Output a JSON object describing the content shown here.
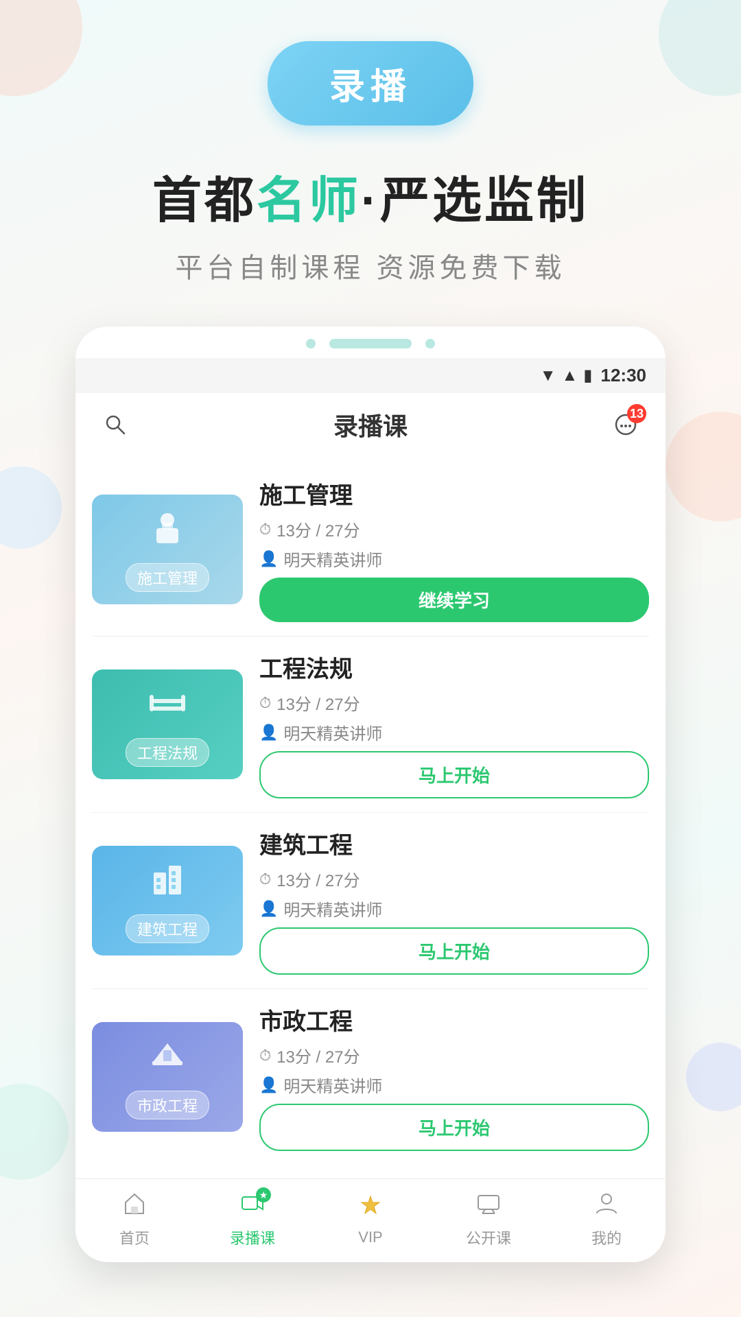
{
  "app": {
    "title": "录播课"
  },
  "header": {
    "button_label": "录播",
    "headline_part1": "首都",
    "headline_accent": "名师",
    "headline_part2": "·严选监制",
    "subheadline": "平台自制课程 资源免费下载"
  },
  "phone": {
    "status": {
      "time": "12:30"
    },
    "topbar": {
      "title": "录播课",
      "search_aria": "搜索",
      "message_badge": "13"
    }
  },
  "courses": [
    {
      "id": "course-1",
      "title": "施工管理",
      "thumb_label": "施工管理",
      "thumb_class": "thumb-施工管理",
      "thumb_icon": "👷",
      "duration": "13分",
      "total": "27分",
      "teacher": "明天精英讲师",
      "action": "继续学习",
      "action_type": "continue"
    },
    {
      "id": "course-2",
      "title": "工程法规",
      "thumb_label": "工程法规",
      "thumb_class": "thumb-工程法规",
      "thumb_icon": "🚧",
      "duration": "13分",
      "total": "27分",
      "teacher": "明天精英讲师",
      "action": "马上开始",
      "action_type": "start"
    },
    {
      "id": "course-3",
      "title": "建筑工程",
      "thumb_label": "建筑工程",
      "thumb_class": "thumb-建筑工程",
      "thumb_icon": "🏗",
      "duration": "13分",
      "total": "27分",
      "teacher": "明天精英讲师",
      "action": "马上开始",
      "action_type": "start"
    },
    {
      "id": "course-4",
      "title": "市政工程",
      "thumb_label": "市政工程",
      "thumb_class": "thumb-市政工程",
      "thumb_icon": "🏛",
      "duration": "13分",
      "total": "27分",
      "teacher": "明天精英讲师",
      "action": "马上开始",
      "action_type": "start"
    }
  ],
  "bottom_nav": [
    {
      "id": "nav-home",
      "icon": "🏠",
      "label": "首页",
      "active": false
    },
    {
      "id": "nav-record",
      "icon": "📹",
      "label": "录播课",
      "active": true
    },
    {
      "id": "nav-vip",
      "icon": "👑",
      "label": "VIP",
      "active": false
    },
    {
      "id": "nav-public",
      "icon": "📺",
      "label": "公开课",
      "active": false
    },
    {
      "id": "nav-mine",
      "icon": "👤",
      "label": "我的",
      "active": false
    }
  ]
}
